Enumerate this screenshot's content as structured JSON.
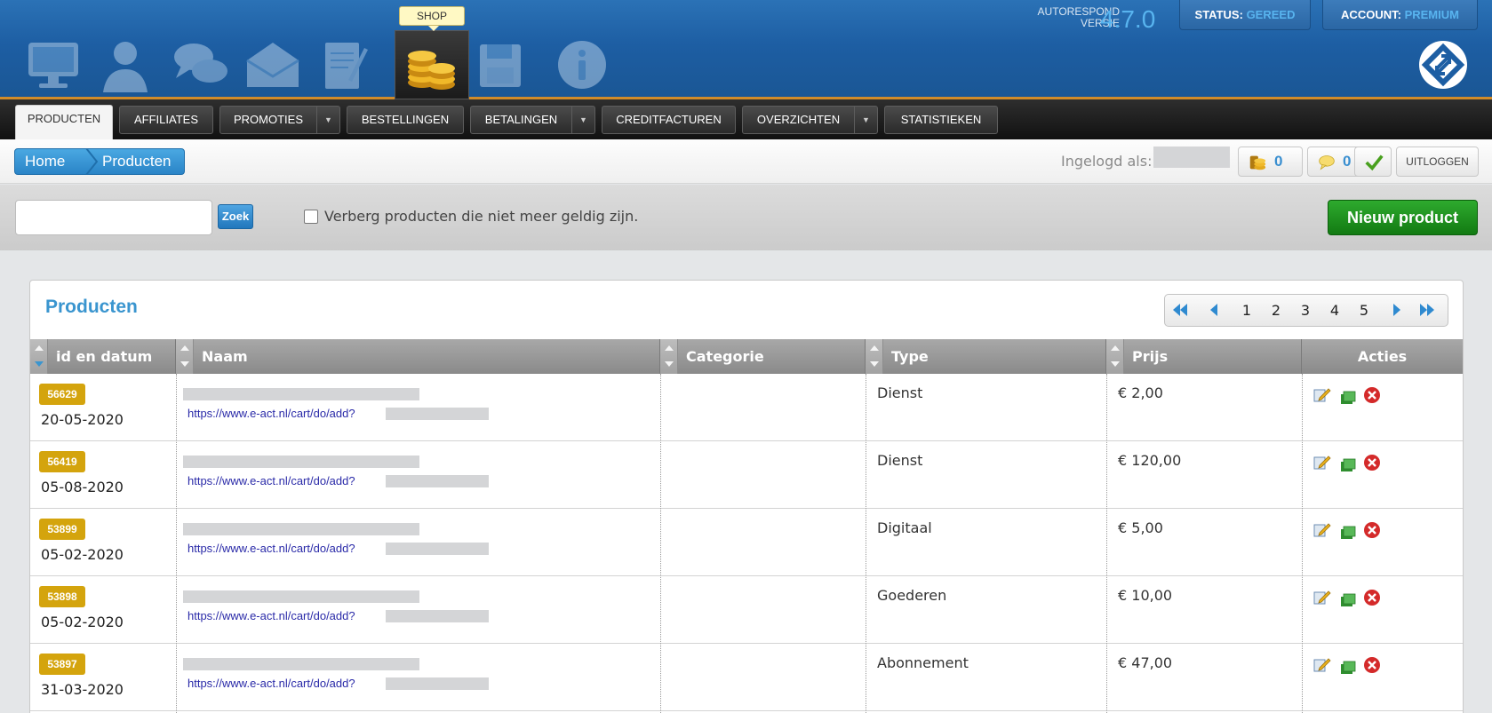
{
  "header": {
    "shop_label": "SHOP",
    "version_label_line1": "AUTORESPOND",
    "version_label_line2": "VERSIE",
    "version_number": "4.7.0",
    "status_label": "STATUS:",
    "status_value": "GEREED",
    "account_label": "ACCOUNT:",
    "account_value": "PREMIUM",
    "nav_icons": [
      "monitor-icon",
      "user-icon",
      "chat-icon",
      "envelope-icon",
      "notepad-icon",
      "coins-icon",
      "save-icon",
      "info-icon"
    ]
  },
  "tabs": [
    {
      "label": "PRODUCTEN",
      "active": true,
      "dropdown": false
    },
    {
      "label": "AFFILIATES",
      "active": false,
      "dropdown": false
    },
    {
      "label": "PROMOTIES",
      "active": false,
      "dropdown": true
    },
    {
      "label": "BESTELLINGEN",
      "active": false,
      "dropdown": false
    },
    {
      "label": "BETALINGEN",
      "active": false,
      "dropdown": true
    },
    {
      "label": "CREDITFACTUREN",
      "active": false,
      "dropdown": false
    },
    {
      "label": "OVERZICHTEN",
      "active": false,
      "dropdown": true
    },
    {
      "label": "STATISTIEKEN",
      "active": false,
      "dropdown": false
    }
  ],
  "breadcrumb": {
    "home": "Home",
    "current": "Producten"
  },
  "user": {
    "logged_in_label": "Ingelogd als:",
    "coins_count": "0",
    "messages_count": "0",
    "logout_label": "UITLOGGEN"
  },
  "search": {
    "value": "",
    "placeholder": "",
    "button_label": "Zoek",
    "hide_invalid_label": "Verberg producten die niet meer geldig zijn.",
    "hide_invalid_checked": false,
    "new_product_label": "Nieuw product"
  },
  "panel": {
    "title": "Producten",
    "pages": [
      "1",
      "2",
      "3",
      "4",
      "5"
    ]
  },
  "table": {
    "columns": [
      "id en datum",
      "Naam",
      "Categorie",
      "Type",
      "Prijs",
      "Acties"
    ],
    "rows": [
      {
        "id": "56629",
        "date": "20-05-2020",
        "link": "https://www.e-act.nl/cart/do/add?",
        "category": "",
        "type": "Dienst",
        "price": "€ 2,00"
      },
      {
        "id": "56419",
        "date": "05-08-2020",
        "link": "https://www.e-act.nl/cart/do/add?",
        "category": "",
        "type": "Dienst",
        "price": "€ 120,00"
      },
      {
        "id": "53899",
        "date": "05-02-2020",
        "link": "https://www.e-act.nl/cart/do/add?",
        "category": "",
        "type": "Digitaal",
        "price": "€ 5,00"
      },
      {
        "id": "53898",
        "date": "05-02-2020",
        "link": "https://www.e-act.nl/cart/do/add?",
        "category": "",
        "type": "Goederen",
        "price": "€ 10,00"
      },
      {
        "id": "53897",
        "date": "31-03-2020",
        "link": "https://www.e-act.nl/cart/do/add?",
        "category": "",
        "type": "Abonnement",
        "price": "€ 47,00"
      }
    ]
  },
  "colors": {
    "header_blue": "#1d5ea3",
    "accent_blue": "#3a95cf",
    "badge_gold": "#d4a40d",
    "new_button_green": "#1f931f",
    "delete_red": "#d42a2a"
  }
}
